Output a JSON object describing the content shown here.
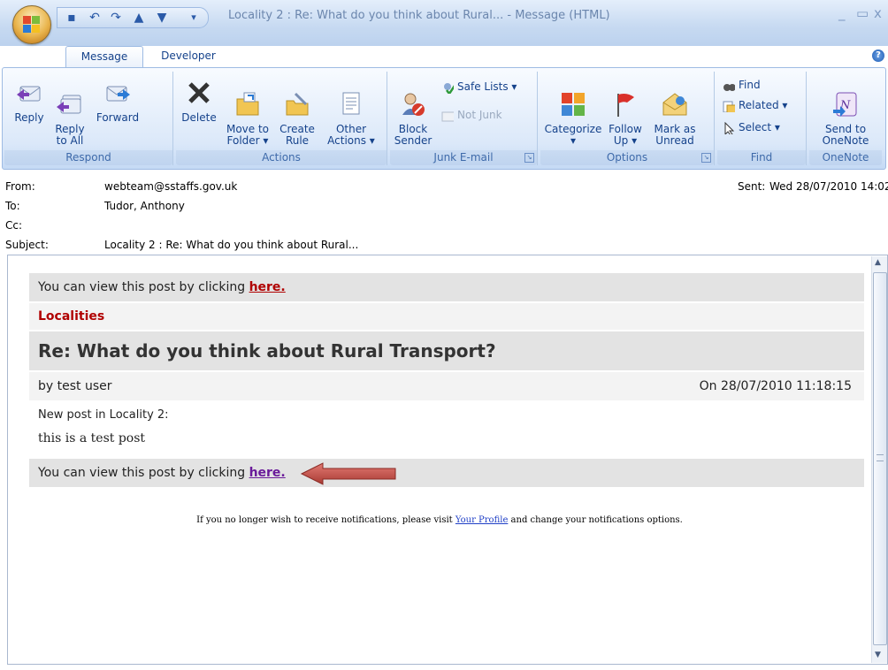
{
  "window": {
    "title": "Locality 2 : Re: What do you think about Rural... - Message (HTML)",
    "controls": [
      "_",
      "▭",
      "x"
    ]
  },
  "tabs": [
    {
      "label": "Message",
      "active": true
    },
    {
      "label": "Developer",
      "active": false
    }
  ],
  "ribbon": {
    "groups": [
      {
        "label": "Respond",
        "buttons": [
          {
            "label": "Reply",
            "icon": "reply-icon"
          },
          {
            "label": "Reply\nto All",
            "icon": "reply-all-icon"
          },
          {
            "label": "Forward",
            "icon": "forward-icon"
          }
        ]
      },
      {
        "label": "Actions",
        "buttons": [
          {
            "label": "Delete",
            "icon": "delete-icon"
          },
          {
            "label": "Move to\nFolder ▾",
            "icon": "move-folder-icon"
          },
          {
            "label": "Create\nRule",
            "icon": "create-rule-icon"
          },
          {
            "label": "Other\nActions ▾",
            "icon": "other-actions-icon"
          }
        ]
      },
      {
        "label": "Junk E-mail",
        "buttons": [
          {
            "label": "Block\nSender",
            "icon": "block-sender-icon"
          },
          {
            "label": "Safe Lists ▾",
            "icon": "safe-lists-icon"
          },
          {
            "label": "Not Junk",
            "icon": "not-junk-icon"
          }
        ]
      },
      {
        "label": "Options",
        "buttons": [
          {
            "label": "Categorize\n▾",
            "icon": "categorize-icon"
          },
          {
            "label": "Follow\nUp ▾",
            "icon": "follow-up-icon"
          },
          {
            "label": "Mark as\nUnread",
            "icon": "mark-unread-icon"
          }
        ]
      },
      {
        "label": "Find",
        "buttons": [
          {
            "label": "Find",
            "icon": "find-icon"
          },
          {
            "label": "Related ▾",
            "icon": "related-icon"
          },
          {
            "label": "Select ▾",
            "icon": "select-icon"
          }
        ]
      },
      {
        "label": "OneNote",
        "buttons": [
          {
            "label": "Send to\nOneNote",
            "icon": "onenote-icon"
          }
        ]
      }
    ]
  },
  "header": {
    "from_label": "From:",
    "from_value": "webteam@sstaffs.gov.uk",
    "to_label": "To:",
    "to_value": "Tudor, Anthony",
    "cc_label": "Cc:",
    "cc_value": "",
    "subject_label": "Subject:",
    "subject_value": "Locality 2 : Re: What do you think about Rural...",
    "sent_label": "Sent:",
    "sent_value": "Wed 28/07/2010 14:02"
  },
  "message": {
    "view_prefix": "You can view this post by clicking",
    "view_link": "here.",
    "category": "Localities",
    "post_title": "Re: What do you think about Rural Transport?",
    "author": "by test user",
    "posted_on": "On 28/07/2010 11:18:15",
    "new_post_line": "New post in Locality 2:",
    "post_body": "this is a test post",
    "footer_prefix": "If you no longer wish to receive notifications, please visit",
    "footer_link": "Your Profile",
    "footer_suffix": "and change your notifications options."
  },
  "colors": {
    "category_red": "#b00000",
    "arrow_red": "#c0504d",
    "ribbon_blue": "#c5daf5"
  }
}
